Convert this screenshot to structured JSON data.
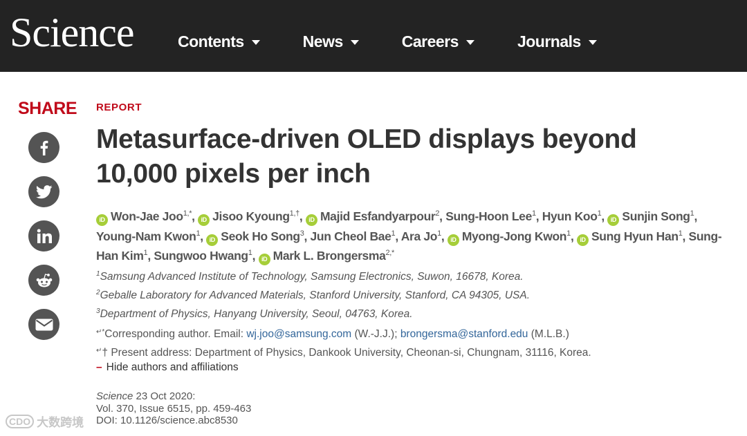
{
  "header": {
    "logo": "Science",
    "nav": [
      {
        "label": "Contents"
      },
      {
        "label": "News"
      },
      {
        "label": "Careers"
      },
      {
        "label": "Journals"
      }
    ]
  },
  "share": {
    "label": "SHARE",
    "buttons": [
      "facebook-icon",
      "twitter-icon",
      "linkedin-icon",
      "reddit-icon",
      "email-icon"
    ]
  },
  "article": {
    "kicker": "REPORT",
    "title": "Metasurface-driven OLED displays beyond 10,000 pixels per inch",
    "orcid_badge": "iD",
    "authors": [
      {
        "name": "Won-Jae Joo",
        "sup": "1,*",
        "orcid": true
      },
      {
        "name": "Jisoo Kyoung",
        "sup": "1,†",
        "orcid": true
      },
      {
        "name": "Majid Esfandyarpour",
        "sup": "2",
        "orcid": true
      },
      {
        "name": "Sung-Hoon Lee",
        "sup": "1",
        "orcid": false
      },
      {
        "name": "Hyun Koo",
        "sup": "1",
        "orcid": false
      },
      {
        "name": "Sunjin Song",
        "sup": "1",
        "orcid": true
      },
      {
        "name": "Young-Nam Kwon",
        "sup": "1",
        "orcid": false
      },
      {
        "name": "Seok Ho Song",
        "sup": "3",
        "orcid": true
      },
      {
        "name": "Jun Cheol Bae",
        "sup": "1",
        "orcid": false
      },
      {
        "name": "Ara Jo",
        "sup": "1",
        "orcid": false
      },
      {
        "name": "Myong-Jong Kwon",
        "sup": "1",
        "orcid": true
      },
      {
        "name": "Sung Hyun Han",
        "sup": "1",
        "orcid": true
      },
      {
        "name": "Sung-Han Kim",
        "sup": "1",
        "orcid": false
      },
      {
        "name": "Sungwoo Hwang",
        "sup": "1",
        "orcid": false
      },
      {
        "name": "Mark L. Brongersma",
        "sup": "2,*",
        "orcid": true
      }
    ],
    "affiliations": [
      {
        "sup": "1",
        "text": "Samsung Advanced Institute of Technology, Samsung Electronics, Suwon, 16678, Korea."
      },
      {
        "sup": "2",
        "text": "Geballe Laboratory for Advanced Materials, Stanford University, Stanford, CA 94305, USA."
      },
      {
        "sup": "3",
        "text": "Department of Physics, Hanyang University, Seoul, 04763, Korea."
      }
    ],
    "corresponding": {
      "mark": "↵*",
      "prefix": "Corresponding author. Email: ",
      "email1": "wj.joo@samsung.com",
      "mid": " (W.-J.J.); ",
      "email2": "brongersma@stanford.edu",
      "suffix": " (M.L.B.)"
    },
    "present_address": {
      "mark": "↵",
      "text": "† Present address: Department of Physics, Dankook University, Cheonan-si, Chungnam, 31116, Korea."
    },
    "hide_link": {
      "symbol": "–",
      "label": "Hide authors and affiliations"
    },
    "citation": {
      "journal": "Science",
      "date": " 23 Oct 2020:",
      "volume": "Vol. 370, Issue 6515, pp. 459-463",
      "doi": "DOI: 10.1126/science.abc8530"
    }
  },
  "watermark": {
    "logo": "CDO",
    "text": "大数跨境"
  },
  "colors": {
    "brand_red": "#c00a1a",
    "header_bg": "#232323",
    "orcid_green": "#a6ce39",
    "link": "#33669a"
  }
}
